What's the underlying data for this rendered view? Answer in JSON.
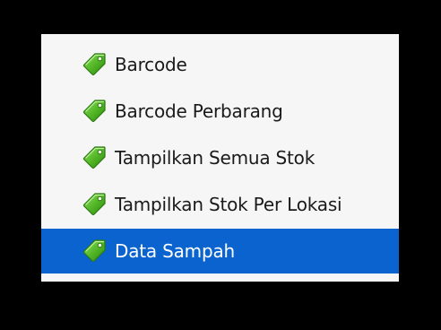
{
  "menu": {
    "items": [
      {
        "label": "Barcode",
        "icon": "tag-icon",
        "selected": false
      },
      {
        "label": "Barcode Perbarang",
        "icon": "tag-icon",
        "selected": false
      },
      {
        "label": "Tampilkan Semua Stok",
        "icon": "tag-icon",
        "selected": false
      },
      {
        "label": "Tampilkan Stok Per Lokasi",
        "icon": "tag-icon",
        "selected": false
      },
      {
        "label": "Data Sampah",
        "icon": "tag-icon",
        "selected": true
      }
    ],
    "colors": {
      "background": "#f6f6f6",
      "selected": "#0a63cf",
      "tag": "#58b82a",
      "text": "#1a1a1a",
      "selected_text": "#ffffff"
    }
  }
}
